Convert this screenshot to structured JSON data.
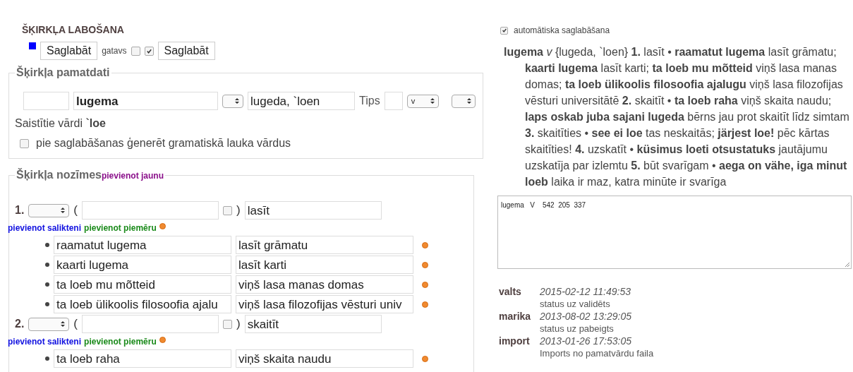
{
  "editor": {
    "title": "ŠĶIRKĻA LABOŠANA",
    "toolbar": [
      {
        "kind": "marker"
      },
      {
        "kind": "button",
        "label": "Saglabāt"
      },
      {
        "kind": "label",
        "label": "gatavs"
      },
      {
        "kind": "checkbox",
        "checked": false
      },
      {
        "kind": "checkbox",
        "checked": true
      },
      {
        "kind": "button",
        "label": "Saglabāt"
      }
    ],
    "basic": {
      "legend": "Šķirkļa pamatdati",
      "fields": [
        {
          "kind": "input"
        },
        {
          "kind": "input",
          "value": "lugema",
          "bold": true
        },
        {
          "kind": "select"
        },
        {
          "kind": "input",
          "value": "lugeda, `loen",
          "bold": false
        },
        {
          "kind": "label",
          "label": "Tips"
        },
        {
          "kind": "input"
        },
        {
          "kind": "select",
          "value": "v"
        },
        {
          "kind": "select"
        }
      ],
      "related": "Saistītie vārdi **`loe**",
      "generate": {
        "label": "pie saglabāšanas ģenerēt gramatiskā lauka vārdus",
        "checked": false
      }
    },
    "meanings": {
      "legend": "Šķirkļa nozīmes",
      "add_link": "pievienot jaunu",
      "senses": [
        {
          "number": "1.",
          "open": "(",
          "close": ")",
          "checked": false,
          "gloss": "lasīt",
          "add_compound": "pievienot salikteni",
          "add_example": "pievienot piemēru",
          "examples": [
            {
              "source": "raamatut lugema",
              "translation": "lasīt grāmatu"
            },
            {
              "source": "kaarti lugema",
              "translation": "lasīt karti"
            },
            {
              "source": "ta loeb mu mõtteid",
              "translation": "viņš lasa manas domas"
            },
            {
              "source": "ta loeb ülikoolis filosoofia ajalu",
              "translation": "viņš lasa filozofijas vēsturi univ"
            }
          ]
        },
        {
          "number": "2.",
          "open": "(",
          "close": ")",
          "checked": false,
          "gloss": "skaitīt",
          "add_compound": "pievienot salikteni",
          "add_example": "pievienot piemēru",
          "examples": [
            {
              "source": "ta loeb raha",
              "translation": "viņš skaita naudu"
            }
          ]
        }
      ]
    }
  },
  "preview": {
    "autosave": {
      "label": "automātiska saglabāšana",
      "checked": true
    },
    "entry": "**lugema** *v* {lugeda, `loen} **1.** lasīt • **raamatut lugema** lasīt grāmatu; **kaarti lugema** lasīt karti; **ta loeb mu mõtteid** viņš lasa manas domas; **ta loeb ülikoolis filosoofia ajalugu** viņš lasa filozofijas vēsturi universitātē **2.** skaitīt • **ta loeb raha** viņš skaita naudu; **laps oskab juba sajani lugeda** bērns jau prot skaitīt līdz simtam **3.** skaitīties • **see ei loe** tas neskaitās; **järjest loe!** pēc kārtas skaitīties! **4.** uzskatīt • **küsimus loeti otsustatuks** jautājumu uzskatīja par izlemtu **5.** būt svarīgam • **aega on vähe, iga minut loeb** laika ir maz, katra minūte ir svarīga",
    "raw": "lugema   V    542  205  337",
    "history": [
      {
        "user": "valts",
        "time": "2015-02-12 11:49:53",
        "note": "status uz validēts"
      },
      {
        "user": "marika",
        "time": "2013-08-02 13:29:05",
        "note": "status uz pabeigts"
      },
      {
        "user": "import",
        "time": "2013-01-26 17:53:05",
        "note": "Imports no pamatvārdu faila"
      }
    ]
  }
}
